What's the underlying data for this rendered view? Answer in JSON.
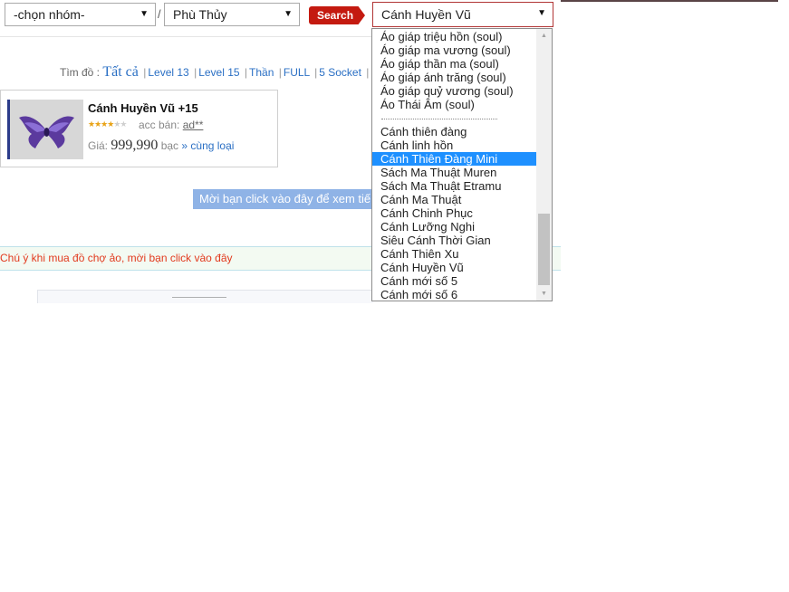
{
  "top": {
    "group_select": "-chọn nhóm-",
    "class_select": "Phù Thủy",
    "slash": "/",
    "search_label": "Search",
    "item_select": "Cánh Huyền Vũ"
  },
  "filters": {
    "prefix": "Tìm đồ :",
    "all": "Tất cả",
    "links": [
      "Level 13",
      "Level 15",
      "Thần",
      "FULL",
      "5 Socket"
    ]
  },
  "card": {
    "title": "Cánh Huyền Vũ +15",
    "rating_filled": 4,
    "rating_total": 6,
    "seller_label": "acc bán:",
    "seller_name": "ad**",
    "price_label": "Giá:",
    "price_value": "999,990",
    "price_unit": "bạc",
    "same_kind": "» cùng loại"
  },
  "blue_button": "Mời bạn click vào đây để xem tiế",
  "notice": "Chú ý khi mua đồ chợ ảo, mời bạn click vào đây",
  "dropdown": {
    "options_top": [
      "Áo giáp triệu hồn (soul)",
      "Áo giáp ma vương (soul)",
      "Áo giáp thần ma (soul)",
      "Áo giáp ánh trăng (soul)",
      "Áo giáp quỷ vương (soul)",
      "Áo Thái Âm (soul)"
    ],
    "options_bottom": [
      "Cánh thiên đàng",
      "Cánh linh hồn",
      "Cánh Thiên Đàng Mini",
      "Sách Ma Thuật Muren",
      "Sách Ma Thuật Etramu",
      "Cánh Ma Thuật",
      "Cánh Chinh Phục",
      "Cánh Lưỡng Nghi",
      "Siêu Cánh Thời Gian",
      "Cánh Thiên Xu",
      "Cánh Huyền Vũ",
      "Cánh mới số 5",
      "Cánh mới số 6"
    ],
    "highlighted": "Cánh Thiên Đàng Mini"
  },
  "colors": {
    "search": "#c41a10",
    "link": "#2a6fc4",
    "highlight": "#1e90ff",
    "notice_text": "#e23a1e"
  }
}
